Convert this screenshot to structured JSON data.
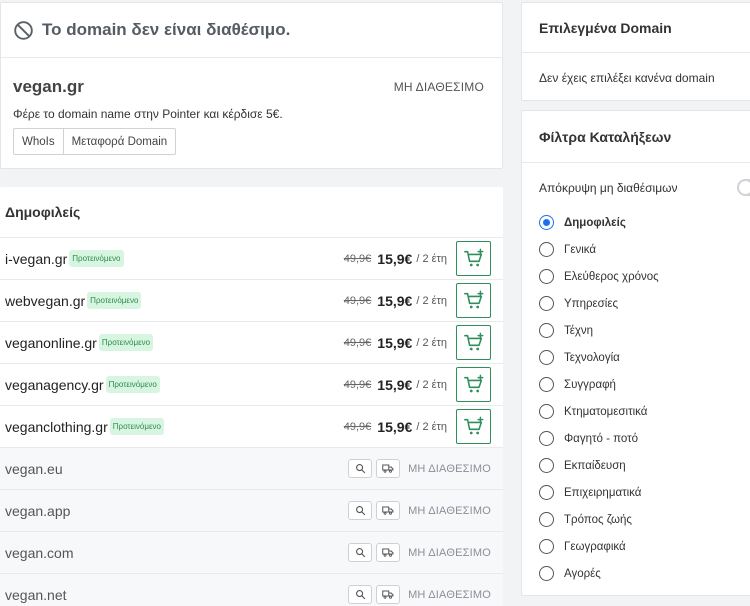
{
  "unavailable": {
    "title": "Το domain δεν είναι διαθέσιμο.",
    "domain": "vegan.gr",
    "status": "ΜΗ ΔΙΑΘΕΣΙΜΟ",
    "promo": "Φέρε το domain name στην Pointer και κέρδισε 5€.",
    "whois_label": "WhoIs",
    "transfer_label": "Μεταφορά Domain"
  },
  "popular": {
    "title": "Δημοφιλείς",
    "available": [
      {
        "name": "i-vegan.gr",
        "badge": "Προτεινόμενο",
        "old_price": "49,9€",
        "price": "15,9€",
        "period": "/ 2 έτη"
      },
      {
        "name": "webvegan.gr",
        "badge": "Προτεινόμενο",
        "old_price": "49,9€",
        "price": "15,9€",
        "period": "/ 2 έτη"
      },
      {
        "name": "veganonline.gr",
        "badge": "Προτεινόμενο",
        "old_price": "49,9€",
        "price": "15,9€",
        "period": "/ 2 έτη"
      },
      {
        "name": "veganagency.gr",
        "badge": "Προτεινόμενο",
        "old_price": "49,9€",
        "price": "15,9€",
        "period": "/ 2 έτη"
      },
      {
        "name": "veganclothing.gr",
        "badge": "Προτεινόμενο",
        "old_price": "49,9€",
        "price": "15,9€",
        "period": "/ 2 έτη"
      }
    ],
    "unavailable": [
      {
        "name": "vegan.eu",
        "status": "ΜΗ ΔΙΑΘΕΣΙΜΟ"
      },
      {
        "name": "vegan.app",
        "status": "ΜΗ ΔΙΑΘΕΣΙΜΟ"
      },
      {
        "name": "vegan.com",
        "status": "ΜΗ ΔΙΑΘΕΣΙΜΟ"
      },
      {
        "name": "vegan.net",
        "status": "ΜΗ ΔΙΑΘΕΣΙΜΟ"
      }
    ]
  },
  "selected": {
    "title": "Επιλεγμένα Domain",
    "empty": "Δεν έχεις επιλέξει κανένα domain"
  },
  "filters": {
    "title": "Φίλτρα Καταλήξεων",
    "hide_unavailable_label": "Απόκρυψη μη διαθέσιμων",
    "hide_unavailable": false,
    "selected": "Δημοφιλείς",
    "options": [
      "Δημοφιλείς",
      "Γενικά",
      "Ελεύθερος χρόνος",
      "Υπηρεσίες",
      "Τέχνη",
      "Τεχνολογία",
      "Συγγραφή",
      "Κτηματομεσιτικά",
      "Φαγητό - ποτό",
      "Εκπαίδευση",
      "Επιχειρηματικά",
      "Τρόπος ζωής",
      "Γεωγραφικά",
      "Αγορές"
    ]
  },
  "colors": {
    "accent": "#2f8f5a",
    "radio": "#1e6ff0",
    "badge_bg": "#d7f5e1"
  }
}
